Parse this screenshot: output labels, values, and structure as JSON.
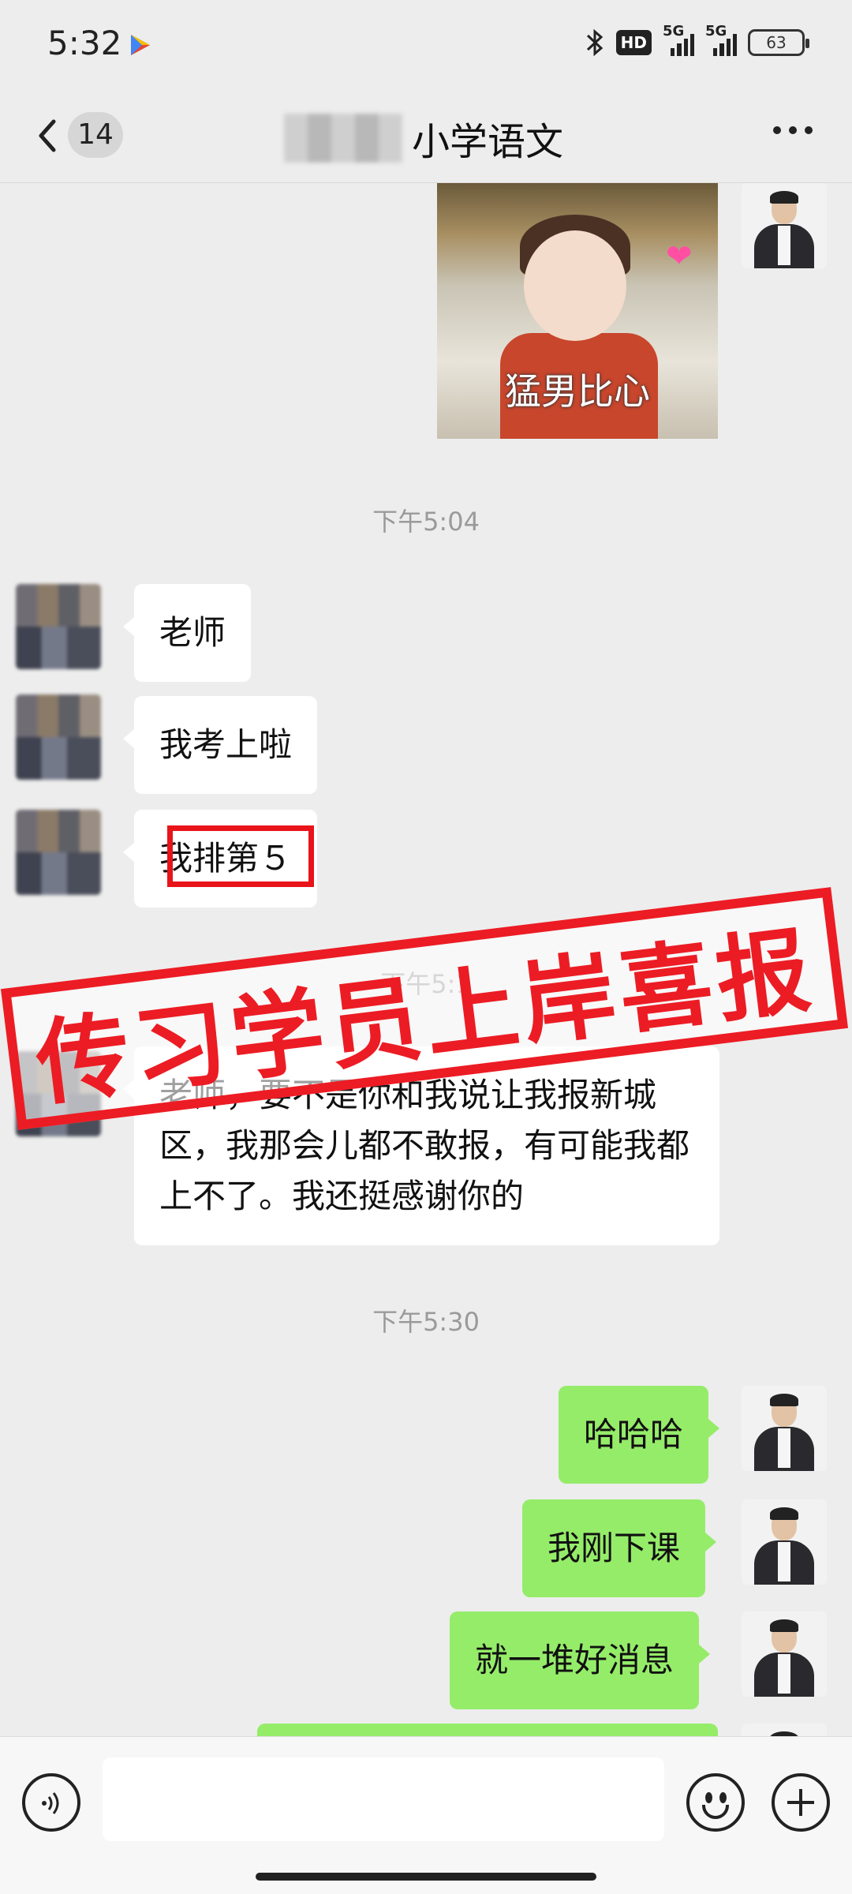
{
  "status_bar": {
    "time": "5:32",
    "hd_label": "HD",
    "signal1": "5G",
    "signal2": "5G",
    "battery": "63"
  },
  "header": {
    "unread_count": "14",
    "title": "小学语文"
  },
  "chat": {
    "image_caption": "猛男比心",
    "time1": "下午5:04",
    "time2": "下午5:1",
    "time3": "下午5:30",
    "messages_left": [
      "老师",
      "我考上啦",
      "我排第５",
      "老师，要不是你和我说让我报新城区，我那会儿都不敢报，有可能我都上不了。我还挺感谢你的"
    ],
    "messages_right": [
      "哈哈哈",
      "我刚下课",
      "就一堆好消息"
    ]
  },
  "overlay": {
    "stamp_text": "传习学员上岸喜报",
    "stamp_color": "#ec1c24"
  },
  "colors": {
    "bubble_right": "#95ec69",
    "bubble_left": "#ffffff",
    "background": "#ededed"
  },
  "icons": [
    "back-icon",
    "more-icon",
    "voice-icon",
    "emoji-icon",
    "plus-icon",
    "bluetooth-icon",
    "play-store-icon"
  ]
}
